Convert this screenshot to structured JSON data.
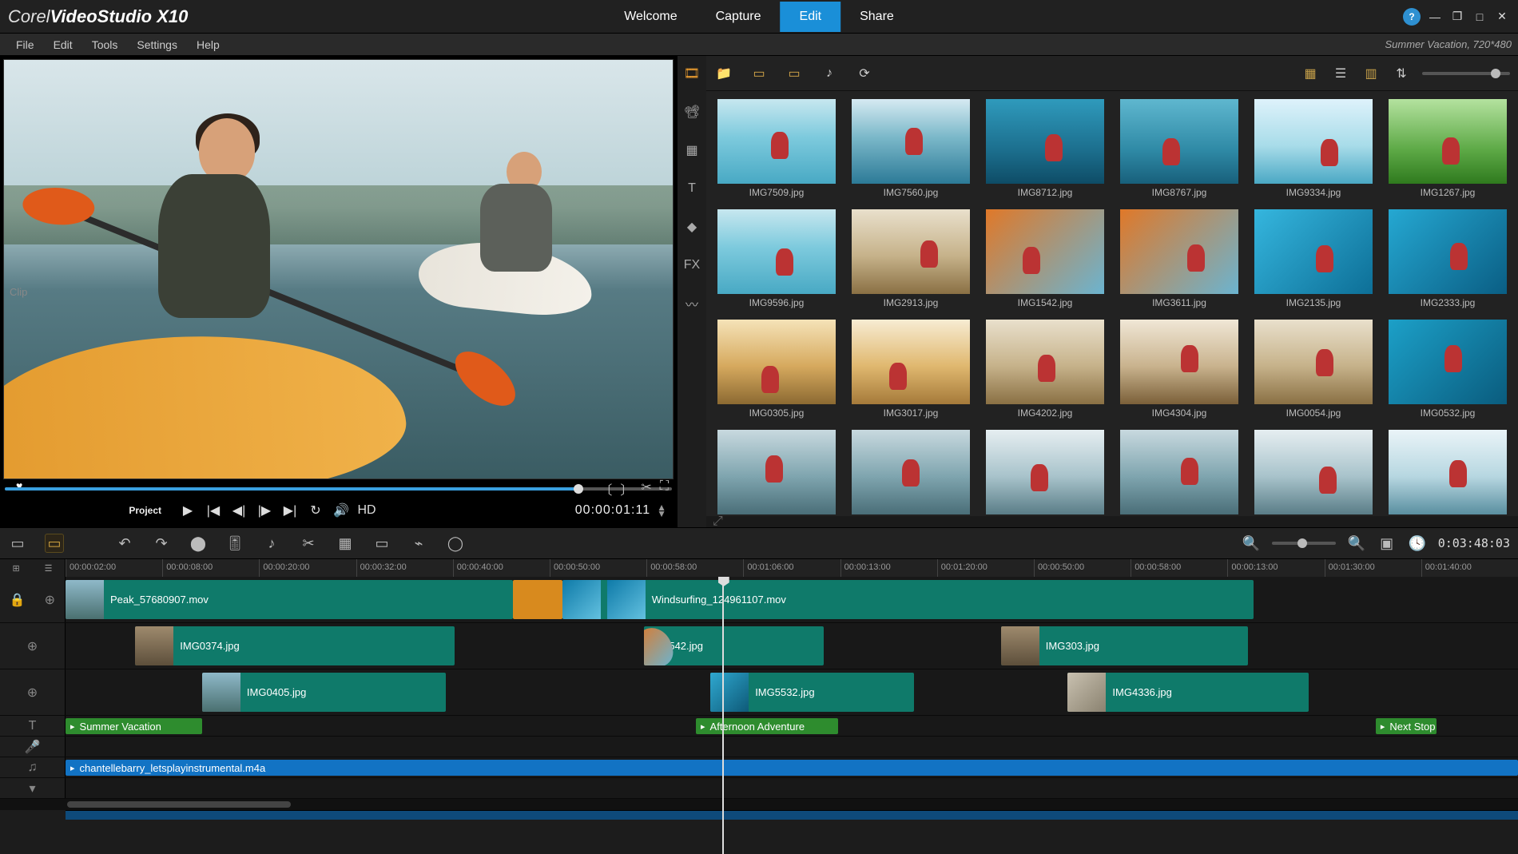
{
  "app": {
    "brand": "Corel",
    "name": "VideoStudio",
    "version": "X10"
  },
  "nav": {
    "welcome": "Welcome",
    "capture": "Capture",
    "edit": "Edit",
    "share": "Share",
    "active": "edit"
  },
  "menu": {
    "file": "File",
    "edit": "Edit",
    "tools": "Tools",
    "settings": "Settings",
    "help": "Help"
  },
  "project_info": "Summer Vacation, 720*480",
  "preview": {
    "mode_project": "Project",
    "mode_clip": "Clip",
    "timecode": "00:00:01:11",
    "hd": "HD"
  },
  "library": {
    "thumbs": [
      [
        "IMG7509.jpg",
        "IMG7560.jpg",
        "IMG8712.jpg",
        "IMG8767.jpg",
        "IMG9334.jpg",
        "IMG1267.jpg"
      ],
      [
        "IMG9596.jpg",
        "IMG2913.jpg",
        "IMG1542.jpg",
        "IMG3611.jpg",
        "IMG2135.jpg",
        "IMG2333.jpg"
      ],
      [
        "IMG0305.jpg",
        "IMG3017.jpg",
        "IMG4202.jpg",
        "IMG4304.jpg",
        "IMG0054.jpg",
        "IMG0532.jpg"
      ],
      [
        "",
        "",
        "",
        "",
        "",
        ""
      ]
    ],
    "palettes": [
      [
        "pal-beach",
        "pal-beach2",
        "pal-under",
        "pal-diver",
        "pal-jump",
        "pal-green"
      ],
      [
        "pal-beach",
        "pal-rock",
        "pal-kayak",
        "pal-kayak",
        "pal-wave",
        "pal-wave2"
      ],
      [
        "pal-sun",
        "pal-sun2",
        "pal-rock",
        "pal-rock2",
        "pal-rock",
        "pal-surf"
      ],
      [
        "pal-hike",
        "pal-hike",
        "pal-hike2",
        "pal-hike",
        "pal-hike2",
        "pal-glacier"
      ]
    ]
  },
  "timeline": {
    "duration": "0:03:48:03",
    "ruler_ticks": [
      "00:00:02:00",
      "00:00:08:00",
      "00:00:20:00",
      "00:00:32:00",
      "00:00:40:00",
      "00:00:50:00",
      "00:00:58:00",
      "00:01:06:00",
      "00:00:13:00",
      "00:01:20:00",
      "00:00:50:00",
      "00:00:58:00",
      "00:00:13:00",
      "00:01:30:00",
      "00:01:40:00"
    ],
    "playhead_pct": 45.2,
    "video_track": [
      {
        "name": "Peak_57680907.mov",
        "left_pct": 0,
        "width_pct": 30.8,
        "thm": "sky1"
      },
      {
        "name": "",
        "left_pct": 30.8,
        "width_pct": 3.4,
        "trans": true
      },
      {
        "name": "Windsurfing_124961107.mov",
        "left_pct": 34.2,
        "width_pct": 47.6,
        "thm": "wind",
        "thm_lead": true
      }
    ],
    "overlay1": [
      {
        "name": "IMG0374.jpg",
        "left_pct": 4.8,
        "width_pct": 22.0,
        "thm": "rock"
      },
      {
        "name": "IMG1542.jpg",
        "left_pct": 39.8,
        "width_pct": 12.4,
        "thm": "kayak"
      },
      {
        "name": "IMG303.jpg",
        "left_pct": 64.4,
        "width_pct": 17.0,
        "thm": "rock"
      }
    ],
    "overlay2": [
      {
        "name": "IMG0405.jpg",
        "left_pct": 9.4,
        "width_pct": 16.8,
        "thm": "sky1"
      },
      {
        "name": "IMG5532.jpg",
        "left_pct": 44.4,
        "width_pct": 14.0,
        "thm": "surf"
      },
      {
        "name": "IMG4336.jpg",
        "left_pct": 69.0,
        "width_pct": 16.6,
        "thm": "fam"
      }
    ],
    "titles": [
      {
        "name": "Summer Vacation",
        "left_pct": 0,
        "width_pct": 9.4
      },
      {
        "name": "Afternoon Adventure",
        "left_pct": 43.4,
        "width_pct": 9.8
      },
      {
        "name": "Next Stop",
        "left_pct": 90.2,
        "width_pct": 4.2
      }
    ],
    "music": {
      "name": "chantellebarry_letsplayinstrumental.m4a",
      "left_pct": 0,
      "width_pct": 100
    }
  }
}
